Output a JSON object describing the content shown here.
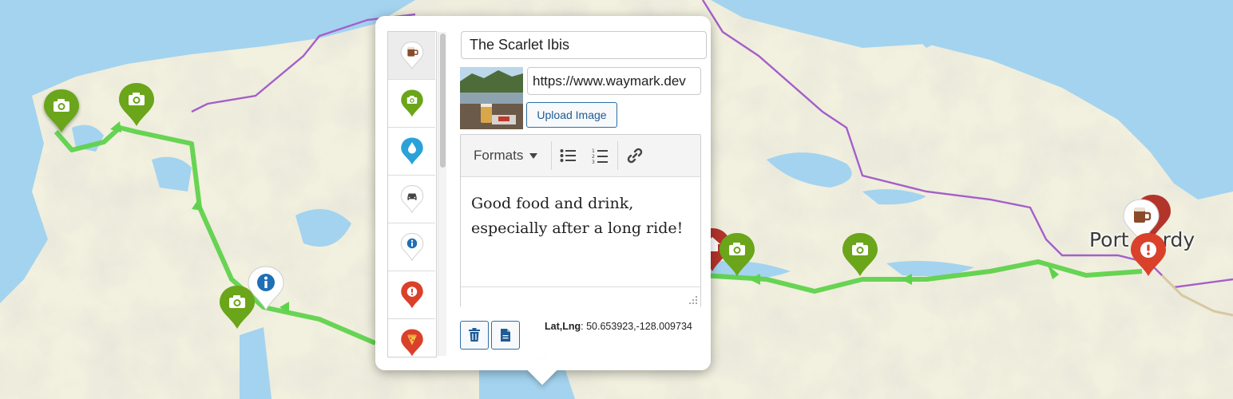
{
  "colors": {
    "water": "#a3d3ef",
    "land": "#f2f0de",
    "route": "#5fd24b",
    "boundary": "#a45fc9",
    "marker_green": "#6ba51a",
    "marker_red": "#d9412b",
    "marker_blue": "#2aa2d9",
    "marker_white": "#ffffff",
    "info_blue": "#1f6fb5"
  },
  "map": {
    "place_label": "Port Hardy",
    "markers": [
      {
        "icon": "camera-icon",
        "color": "#6ba51a"
      },
      {
        "icon": "camera-icon",
        "color": "#6ba51a"
      },
      {
        "icon": "info-icon",
        "color": "#ffffff"
      },
      {
        "icon": "camera-icon",
        "color": "#6ba51a"
      },
      {
        "icon": "home-icon",
        "color": "#b3342a"
      },
      {
        "icon": "camera-icon",
        "color": "#6ba51a"
      },
      {
        "icon": "camera-icon",
        "color": "#6ba51a"
      },
      {
        "icon": "beer-mug-icon",
        "color": "#b3342a"
      },
      {
        "icon": "beer-mug-icon",
        "color": "#ffffff"
      },
      {
        "icon": "alert-icon",
        "color": "#d9412b"
      }
    ]
  },
  "popup": {
    "title_value": "The Scarlet Ibis",
    "image_url_value": "https://www.waymark.dev",
    "upload_label": "Upload Image",
    "editor": {
      "formats_label": "Formats",
      "description": "Good food and drink, especially after a long ride!"
    },
    "latlng_label": "Lat,Lng",
    "latlng_value": ": 50.653923,-128.009734",
    "marker_types": [
      {
        "icon": "beer-mug-icon",
        "color": "#ffffff",
        "active": true
      },
      {
        "icon": "camera-icon",
        "color": "#6ba51a"
      },
      {
        "icon": "water-drop-icon",
        "color": "#2aa2d9"
      },
      {
        "icon": "car-icon",
        "color": "#ffffff"
      },
      {
        "icon": "info-icon",
        "color": "#ffffff"
      },
      {
        "icon": "alert-icon",
        "color": "#d9412b"
      },
      {
        "icon": "pizza-icon",
        "color": "#d9412b"
      }
    ]
  }
}
